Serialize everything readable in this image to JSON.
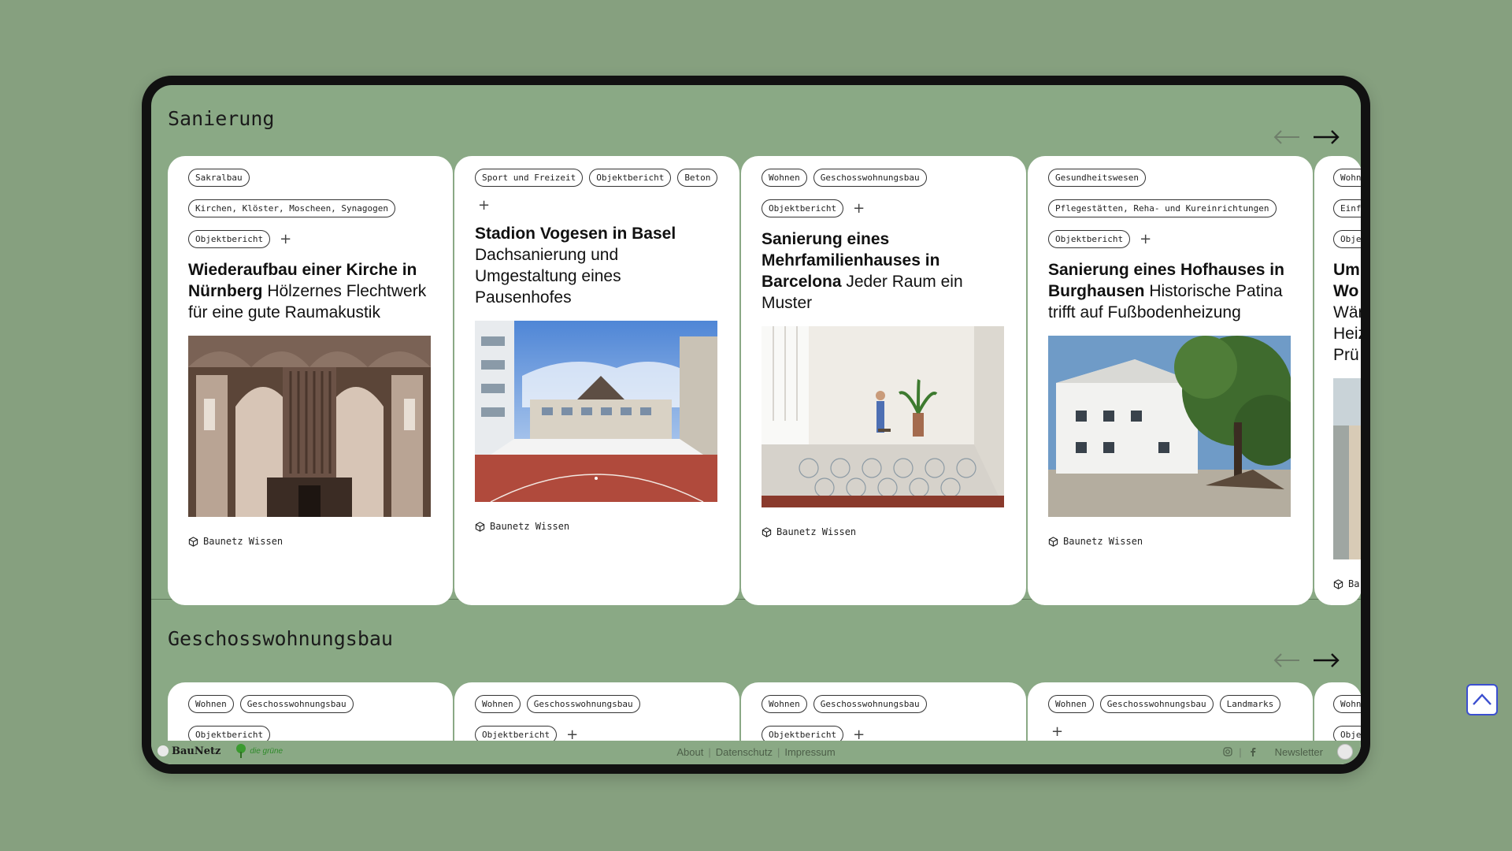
{
  "sections": [
    {
      "title": "Sanierung",
      "cards": [
        {
          "tags": [
            "Sakralbau",
            "Kirchen, Klöster, Moscheen, Synagogen",
            "Objektbericht"
          ],
          "title_bold": "Wiederaufbau einer Kirche in Nürnberg",
          "title_rest": " Hölzernes Flechtwerk für eine gute Raumakustik",
          "source": "Baunetz Wissen"
        },
        {
          "tags": [
            "Sport und Freizeit",
            "Objektbericht",
            "Beton"
          ],
          "title_bold": "Stadion Vogesen in Basel",
          "title_rest": " Dachsanierung und Umgestaltung eines Pausenhofes",
          "source": "Baunetz Wissen"
        },
        {
          "tags": [
            "Wohnen",
            "Geschosswohnungsbau",
            "Objektbericht"
          ],
          "title_bold": "Sanierung eines Mehrfamilienhauses in Barcelona",
          "title_rest": " Jeder Raum ein Muster",
          "source": "Baunetz Wissen"
        },
        {
          "tags": [
            "Gesundheitswesen",
            "Pflegestätten, Reha- und Kureinrichtungen",
            "Objektbericht"
          ],
          "title_bold": "Sanierung eines Hofhauses in Burghausen",
          "title_rest": " Historische Patina trifft auf Fußbodenheizung",
          "source": "Baunetz Wissen"
        },
        {
          "tags": [
            "Wohn",
            "Einf",
            "Obje"
          ],
          "title_bold": "Um Wo",
          "title_rest": " Wär Heiz Prü",
          "source": "Ba"
        }
      ]
    },
    {
      "title": "Geschosswohnungsbau",
      "cards": [
        {
          "tags": [
            "Wohnen",
            "Geschosswohnungsbau",
            "Objektbericht"
          ]
        },
        {
          "tags": [
            "Wohnen",
            "Geschosswohnungsbau",
            "Objektbericht"
          ]
        },
        {
          "tags": [
            "Wohnen",
            "Geschosswohnungsbau",
            "Objektbericht"
          ]
        },
        {
          "tags": [
            "Wohnen",
            "Geschosswohnungsbau",
            "Landmarks"
          ]
        },
        {
          "tags": [
            "Wohn",
            "Obje"
          ]
        }
      ]
    }
  ],
  "footer": {
    "brand": "BauNetz",
    "green_brand": "die grüne",
    "links": [
      "About",
      "Datenschutz",
      "Impressum"
    ],
    "newsletter": "Newsletter"
  },
  "icons": {
    "prev": "arrow-left-icon",
    "next": "arrow-right-icon",
    "add": "plus-icon",
    "source": "cube-icon",
    "up": "chevron-up-icon"
  },
  "colors": {
    "background": "#86a07f",
    "screen": "#8aa985",
    "accent_button": "#3b4fd0"
  }
}
